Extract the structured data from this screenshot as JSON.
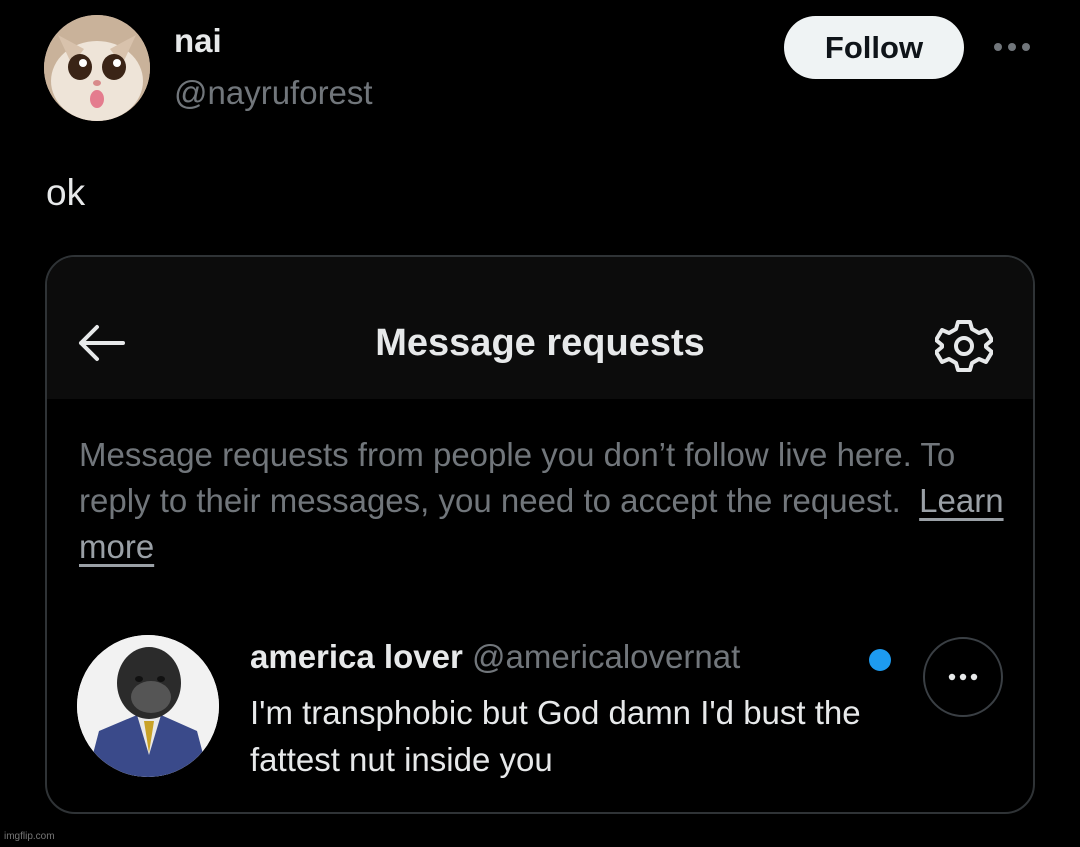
{
  "tweet": {
    "display_name": "nai",
    "handle": "@nayruforest",
    "follow_label": "Follow",
    "text": "ok",
    "avatar_icon": "cat-face-avatar",
    "more_icon": "more-horizontal-icon"
  },
  "embedded": {
    "title": "Message requests",
    "back_icon": "arrow-left-icon",
    "settings_icon": "gear-icon",
    "description": "Message requests from people you don’t follow live here. To reply to their messages, you need to accept the request.",
    "learn_more": "Learn more",
    "request": {
      "name": "america lover",
      "handle": "@americalovernat",
      "message": "I'm transphobic but God damn I'd bust the fattest nut inside you",
      "avatar_icon": "gorilla-in-suit-avatar",
      "unread": true
    }
  },
  "watermark": "imgflip.com",
  "colors": {
    "background": "#000000",
    "primary_text": "#e7e9ea",
    "secondary_text": "#71767b",
    "accent_blue": "#1d9bf0",
    "follow_button_bg": "#eff3f4"
  }
}
